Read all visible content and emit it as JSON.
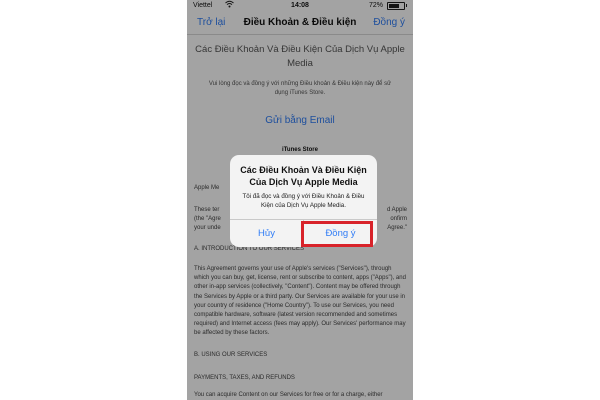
{
  "status_bar": {
    "carrier": "Viettel",
    "time": "14:08",
    "battery": "72%",
    "battery_level": 0.72,
    "wifi_icon": "wifi-icon"
  },
  "nav": {
    "back_label": "Trở lại",
    "title": "Điều Khoản & Điều kiện",
    "agree_label": "Đồng ý"
  },
  "content": {
    "title": "Các Điều Khoản Và Điều Kiện Của Dịch Vụ Apple Media",
    "intro": "Vui lòng đọc và đồng ý với những Điều khoản & Điều kiện này để sử dụng iTunes Store.",
    "email_link": "Gửi bằng Email",
    "store_heading": "iTunes Store",
    "apple_media_partial": "Apple Me",
    "these_partial": "These ter",
    "the_partial": "(the \"Agre",
    "your_partial": "your unde",
    "right1_partial": "d Apple",
    "right2_partial": "onfirm",
    "right3_partial": "Agree.\"",
    "section_a": "A. INTRODUCTION TO OUR SERVICES",
    "body": "This Agreement governs your use of Apple's services (\"Services\"), through which you can buy, get, license, rent or subscribe to content, apps (\"Apps\"), and other in-app services (collectively, \"Content\"). Content may be offered through the Services by Apple or a third party. Our Services are available for your use in your country of residence (\"Home Country\"). To use our Services, you need compatible hardware, software (latest version recommended and sometimes required) and Internet access (fees may apply). Our Services' performance may be affected by these factors.",
    "section_b": "B. USING OUR SERVICES",
    "payments": "PAYMENTS, TAXES, AND REFUNDS",
    "last_line": "You can acquire Content on our Services for free or for a charge, either"
  },
  "alert": {
    "title": "Các Điều Khoản Và Điều Kiện Của Dịch Vụ Apple Media",
    "message": "Tôi đã đọc và đồng ý với Điều Khoản & Điều Kiện của Dịch Vụ Apple Media.",
    "cancel_label": "Hủy",
    "confirm_label": "Đồng ý"
  },
  "colors": {
    "accent": "#2f7cf6",
    "highlight": "#d8232a"
  }
}
